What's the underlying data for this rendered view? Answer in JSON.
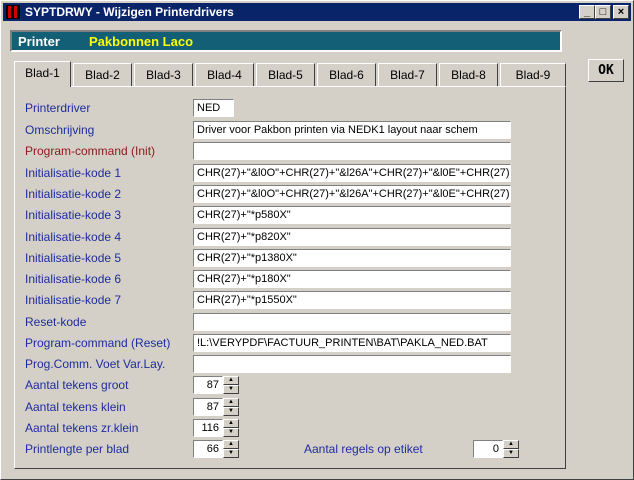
{
  "window": {
    "title": "SYPTDRWY - Wijzigen Printerdrivers"
  },
  "printer": {
    "label": "Printer",
    "value": "Pakbonnen Laco"
  },
  "ok_label": "OK",
  "tabs": [
    "Blad-1",
    "Blad-2",
    "Blad-3",
    "Blad-4",
    "Blad-5",
    "Blad-6",
    "Blad-7",
    "Blad-8",
    "Blad-9"
  ],
  "fields": [
    {
      "label": "Printerdriver",
      "value": "NED"
    },
    {
      "label": "Omschrijving",
      "value": "Driver voor Pakbon printen via NEDK1 layout naar schem"
    },
    {
      "label": "Program-command (Init)",
      "value": ""
    },
    {
      "label": "Initialisatie-kode 1",
      "value": "CHR(27)+\"&l0O\"+CHR(27)+\"&l26A\"+CHR(27)+\"&l0E\"+CHR(27)+\""
    },
    {
      "label": "Initialisatie-kode 2",
      "value": "CHR(27)+\"&l0O\"+CHR(27)+\"&l26A\"+CHR(27)+\"&l0E\"+CHR(27)+\""
    },
    {
      "label": "Initialisatie-kode 3",
      "value": "CHR(27)+\"*p580X\""
    },
    {
      "label": "Initialisatie-kode 4",
      "value": "CHR(27)+\"*p820X\""
    },
    {
      "label": "Initialisatie-kode 5",
      "value": "CHR(27)+\"*p1380X\""
    },
    {
      "label": "Initialisatie-kode 6",
      "value": "CHR(27)+\"*p180X\""
    },
    {
      "label": "Initialisatie-kode 7",
      "value": "CHR(27)+\"*p1550X\""
    },
    {
      "label": "Reset-kode",
      "value": ""
    },
    {
      "label": "Program-command (Reset)",
      "value": "!L:\\VERYPDF\\FACTUUR_PRINTEN\\BAT\\PAKLA_NED.BAT"
    },
    {
      "label": "Prog.Comm. Voet Var.Lay.",
      "value": ""
    }
  ],
  "spinners": [
    {
      "label": "Aantal tekens groot",
      "value": "87"
    },
    {
      "label": "Aantal tekens klein",
      "value": "87"
    },
    {
      "label": "Aantal tekens zr.klein",
      "value": "116"
    },
    {
      "label": "Printlengte per blad",
      "value": "66"
    }
  ],
  "etiket": {
    "label": "Aantal regels op etiket",
    "value": "0"
  },
  "colors": {
    "title_bg": "#0a246a",
    "printer_bar": "#135f75",
    "label_blue": "#1e2ca0",
    "label_red": "#8b1a1a",
    "printer_value": "#ffff00"
  }
}
